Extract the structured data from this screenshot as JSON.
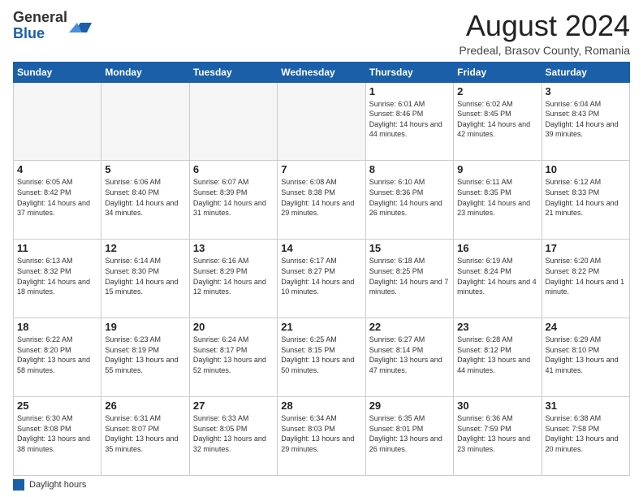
{
  "header": {
    "logo_general": "General",
    "logo_blue": "Blue",
    "month_year": "August 2024",
    "location": "Predeal, Brasov County, Romania"
  },
  "days_of_week": [
    "Sunday",
    "Monday",
    "Tuesday",
    "Wednesday",
    "Thursday",
    "Friday",
    "Saturday"
  ],
  "weeks": [
    [
      {
        "day": "",
        "info": ""
      },
      {
        "day": "",
        "info": ""
      },
      {
        "day": "",
        "info": ""
      },
      {
        "day": "",
        "info": ""
      },
      {
        "day": "1",
        "info": "Sunrise: 6:01 AM\nSunset: 8:46 PM\nDaylight: 14 hours and 44 minutes."
      },
      {
        "day": "2",
        "info": "Sunrise: 6:02 AM\nSunset: 8:45 PM\nDaylight: 14 hours and 42 minutes."
      },
      {
        "day": "3",
        "info": "Sunrise: 6:04 AM\nSunset: 8:43 PM\nDaylight: 14 hours and 39 minutes."
      }
    ],
    [
      {
        "day": "4",
        "info": "Sunrise: 6:05 AM\nSunset: 8:42 PM\nDaylight: 14 hours and 37 minutes."
      },
      {
        "day": "5",
        "info": "Sunrise: 6:06 AM\nSunset: 8:40 PM\nDaylight: 14 hours and 34 minutes."
      },
      {
        "day": "6",
        "info": "Sunrise: 6:07 AM\nSunset: 8:39 PM\nDaylight: 14 hours and 31 minutes."
      },
      {
        "day": "7",
        "info": "Sunrise: 6:08 AM\nSunset: 8:38 PM\nDaylight: 14 hours and 29 minutes."
      },
      {
        "day": "8",
        "info": "Sunrise: 6:10 AM\nSunset: 8:36 PM\nDaylight: 14 hours and 26 minutes."
      },
      {
        "day": "9",
        "info": "Sunrise: 6:11 AM\nSunset: 8:35 PM\nDaylight: 14 hours and 23 minutes."
      },
      {
        "day": "10",
        "info": "Sunrise: 6:12 AM\nSunset: 8:33 PM\nDaylight: 14 hours and 21 minutes."
      }
    ],
    [
      {
        "day": "11",
        "info": "Sunrise: 6:13 AM\nSunset: 8:32 PM\nDaylight: 14 hours and 18 minutes."
      },
      {
        "day": "12",
        "info": "Sunrise: 6:14 AM\nSunset: 8:30 PM\nDaylight: 14 hours and 15 minutes."
      },
      {
        "day": "13",
        "info": "Sunrise: 6:16 AM\nSunset: 8:29 PM\nDaylight: 14 hours and 12 minutes."
      },
      {
        "day": "14",
        "info": "Sunrise: 6:17 AM\nSunset: 8:27 PM\nDaylight: 14 hours and 10 minutes."
      },
      {
        "day": "15",
        "info": "Sunrise: 6:18 AM\nSunset: 8:25 PM\nDaylight: 14 hours and 7 minutes."
      },
      {
        "day": "16",
        "info": "Sunrise: 6:19 AM\nSunset: 8:24 PM\nDaylight: 14 hours and 4 minutes."
      },
      {
        "day": "17",
        "info": "Sunrise: 6:20 AM\nSunset: 8:22 PM\nDaylight: 14 hours and 1 minute."
      }
    ],
    [
      {
        "day": "18",
        "info": "Sunrise: 6:22 AM\nSunset: 8:20 PM\nDaylight: 13 hours and 58 minutes."
      },
      {
        "day": "19",
        "info": "Sunrise: 6:23 AM\nSunset: 8:19 PM\nDaylight: 13 hours and 55 minutes."
      },
      {
        "day": "20",
        "info": "Sunrise: 6:24 AM\nSunset: 8:17 PM\nDaylight: 13 hours and 52 minutes."
      },
      {
        "day": "21",
        "info": "Sunrise: 6:25 AM\nSunset: 8:15 PM\nDaylight: 13 hours and 50 minutes."
      },
      {
        "day": "22",
        "info": "Sunrise: 6:27 AM\nSunset: 8:14 PM\nDaylight: 13 hours and 47 minutes."
      },
      {
        "day": "23",
        "info": "Sunrise: 6:28 AM\nSunset: 8:12 PM\nDaylight: 13 hours and 44 minutes."
      },
      {
        "day": "24",
        "info": "Sunrise: 6:29 AM\nSunset: 8:10 PM\nDaylight: 13 hours and 41 minutes."
      }
    ],
    [
      {
        "day": "25",
        "info": "Sunrise: 6:30 AM\nSunset: 8:08 PM\nDaylight: 13 hours and 38 minutes."
      },
      {
        "day": "26",
        "info": "Sunrise: 6:31 AM\nSunset: 8:07 PM\nDaylight: 13 hours and 35 minutes."
      },
      {
        "day": "27",
        "info": "Sunrise: 6:33 AM\nSunset: 8:05 PM\nDaylight: 13 hours and 32 minutes."
      },
      {
        "day": "28",
        "info": "Sunrise: 6:34 AM\nSunset: 8:03 PM\nDaylight: 13 hours and 29 minutes."
      },
      {
        "day": "29",
        "info": "Sunrise: 6:35 AM\nSunset: 8:01 PM\nDaylight: 13 hours and 26 minutes."
      },
      {
        "day": "30",
        "info": "Sunrise: 6:36 AM\nSunset: 7:59 PM\nDaylight: 13 hours and 23 minutes."
      },
      {
        "day": "31",
        "info": "Sunrise: 6:38 AM\nSunset: 7:58 PM\nDaylight: 13 hours and 20 minutes."
      }
    ]
  ],
  "footer": {
    "legend_label": "Daylight hours"
  }
}
